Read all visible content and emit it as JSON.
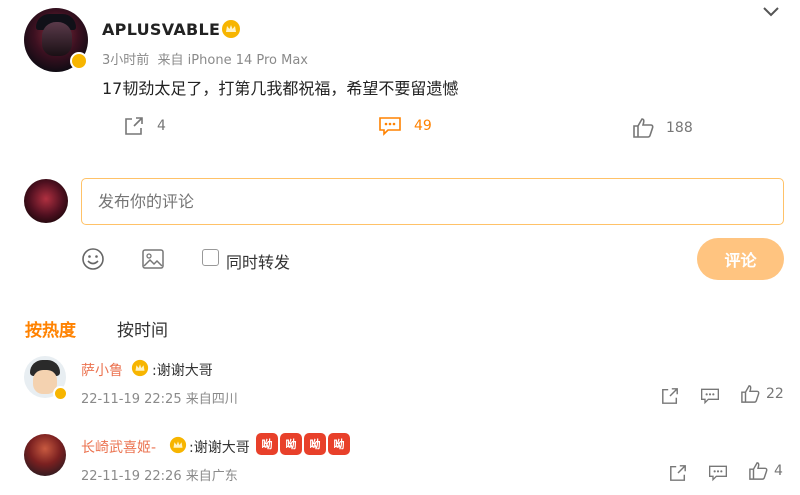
{
  "post": {
    "username": "APLUSVABLE",
    "time": "3小时前",
    "source": "来自 iPhone 14 Pro Max",
    "text": "17韧劲太足了，打第几我都祝福，希望不要留遗憾",
    "reposts": "4",
    "comments": "49",
    "likes": "188"
  },
  "composer": {
    "placeholder": "发布你的评论",
    "repost_label": "同时转发",
    "submit_label": "评论"
  },
  "sort_tabs": [
    "按热度",
    "按时间"
  ],
  "comments": [
    {
      "name": "萨小鲁",
      "text": ":谢谢大哥",
      "date": "22-11-19 22:25 来自四川",
      "likes": "22"
    },
    {
      "name": "长崎武喜姬-",
      "text": ":谢谢大哥",
      "emoji_text": "呦",
      "date": "22-11-19 22:26 来自广东",
      "likes": "4"
    }
  ],
  "colors": {
    "accent": "#ff8200",
    "name": "#eb7350",
    "input_border": "#ffc268",
    "submit_bg": "#ffc480",
    "gold": "#f7b500"
  }
}
